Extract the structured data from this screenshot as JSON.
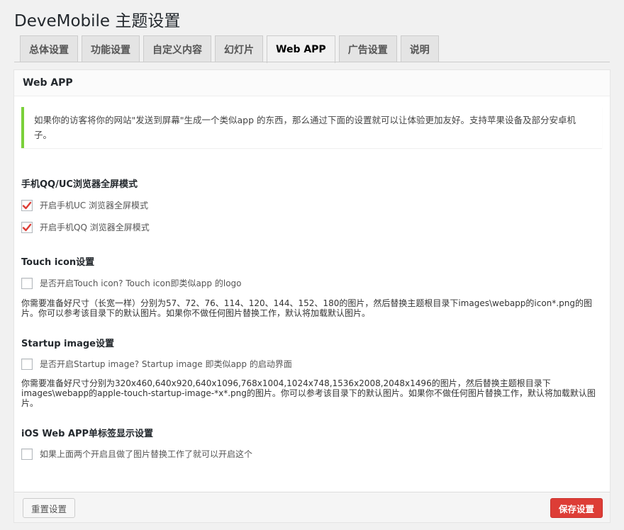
{
  "page": {
    "title": "DeveMobile 主题设置"
  },
  "tabs": [
    {
      "label": "总体设置"
    },
    {
      "label": "功能设置"
    },
    {
      "label": "自定义内容"
    },
    {
      "label": "幻灯片"
    },
    {
      "label": "Web APP"
    },
    {
      "label": "广告设置"
    },
    {
      "label": "说明"
    }
  ],
  "panel": {
    "title": "Web APP",
    "notice": "如果你的访客将你的网站\"发送到屏幕\"生成一个类似app 的东西，那么通过下面的设置就可以让体验更加友好。支持苹果设备及部分安卓机子。",
    "sections": [
      {
        "title": "手机QQ/UC浏览器全屏模式",
        "options": [
          {
            "label": "开启手机UC 浏览器全屏模式",
            "checked": true
          },
          {
            "label": "开启手机QQ 浏览器全屏模式",
            "checked": true
          }
        ]
      },
      {
        "title": "Touch icon设置",
        "options": [
          {
            "label": "是否开启Touch icon?  Touch icon即类似app 的logo",
            "checked": false
          }
        ],
        "desc": "你需要准备好尺寸（长宽一样）分别为57、72、76、114、120、144、152、180的图片，然后替换主题根目录下images\\webapp的icon*.png的图片。你可以参考该目录下的默认图片。如果你不做任何图片替换工作，默认将加载默认图片。"
      },
      {
        "title": "Startup image设置",
        "options": [
          {
            "label": "是否开启Startup image?  Startup image 即类似app 的启动界面",
            "checked": false
          }
        ],
        "desc": "你需要准备好尺寸分别为320x460,640x920,640x1096,768x1004,1024x748,1536x2008,2048x1496的图片，然后替换主题根目录下images\\webapp的apple-touch-startup-image-*x*.png的图片。你可以参考该目录下的默认图片。如果你不做任何图片替换工作，默认将加载默认图片。"
      },
      {
        "title": "iOS Web APP单标签显示设置",
        "options": [
          {
            "label": "如果上面两个开启且做了图片替换工作了就可以开启这个",
            "checked": false
          }
        ]
      }
    ]
  },
  "footer": {
    "reset_label": "重置设置",
    "save_label": "保存设置"
  },
  "colors": {
    "accent_green": "#7ad03a",
    "save_red": "#dd3d36",
    "check_red": "#dd3d36"
  }
}
